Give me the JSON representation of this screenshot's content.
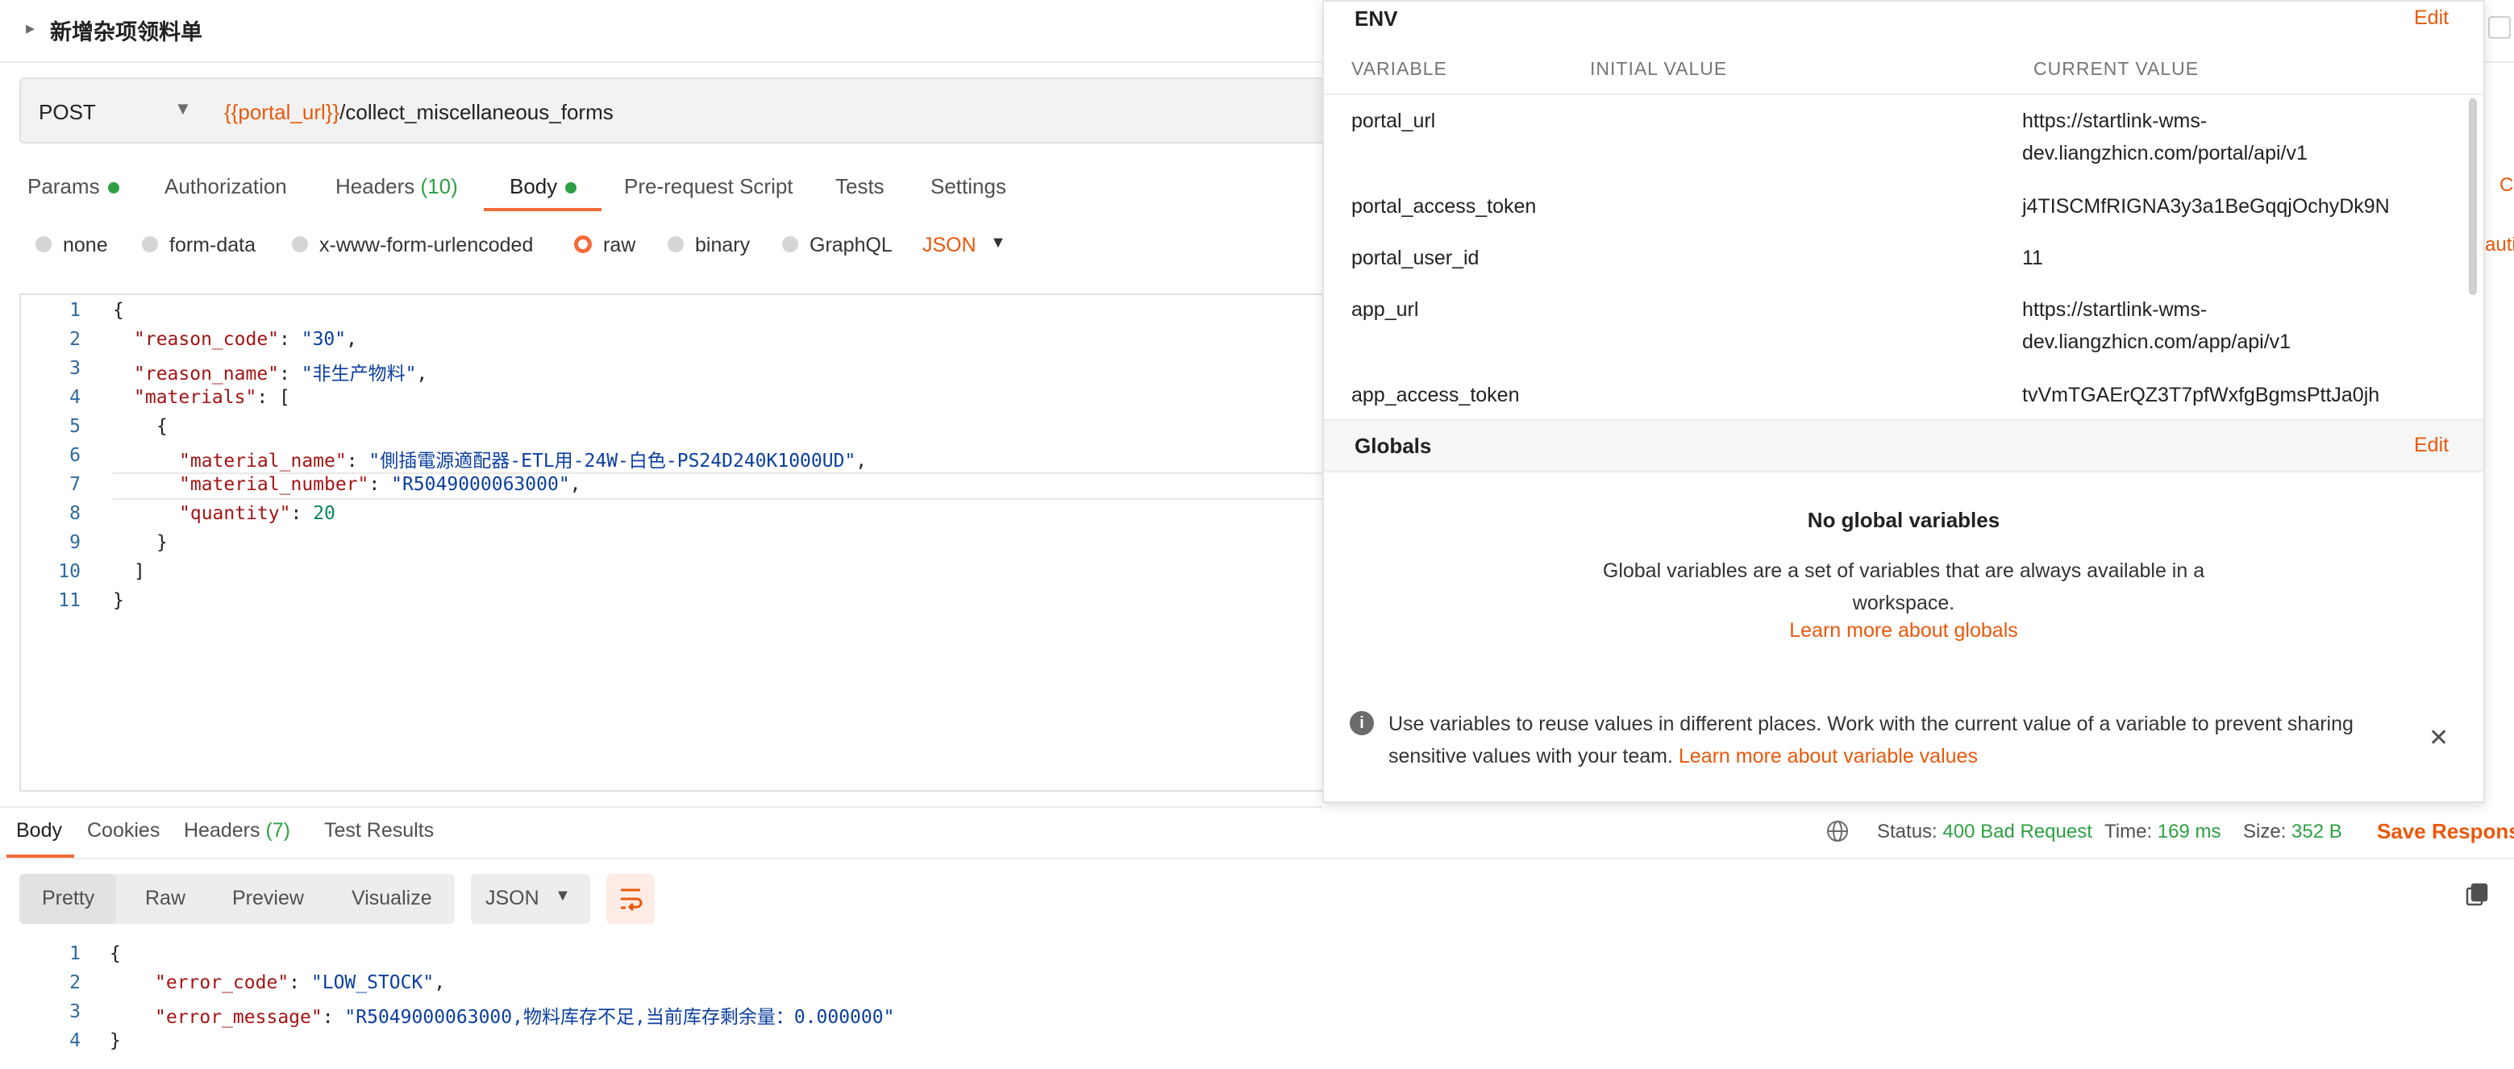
{
  "request": {
    "title": "新增杂项领料单",
    "method": "POST",
    "url_variable": "{{portal_url}}",
    "url_path": "/collect_miscellaneous_forms",
    "tabs": {
      "params": "Params",
      "authorization": "Authorization",
      "headers": "Headers",
      "headers_count": "(10)",
      "body": "Body",
      "prerequest": "Pre-request Script",
      "tests": "Tests",
      "settings": "Settings"
    },
    "body_types": {
      "none": "none",
      "form_data": "form-data",
      "urlencoded": "x-www-form-urlencoded",
      "raw": "raw",
      "binary": "binary",
      "graphql": "GraphQL",
      "format": "JSON"
    },
    "code": {
      "l1": "{",
      "l2_key": "\"reason_code\"",
      "l2_val": "\"30\"",
      "l3_key": "\"reason_name\"",
      "l3_val": "\"非生产物料\"",
      "l4_key": "\"materials\"",
      "l5": "{",
      "l6_key": "\"material_name\"",
      "l6_val": "\"側插電源適配器-ETL用-24W-白色-PS24D240K1000UD\"",
      "l7_key": "\"material_number\"",
      "l7_val": "\"R5049000063000\"",
      "l8_key": "\"quantity\"",
      "l8_val": "20",
      "l9": "}",
      "l10": "]",
      "l11": "}"
    },
    "line_numbers": [
      "1",
      "2",
      "3",
      "4",
      "5",
      "6",
      "7",
      "8",
      "9",
      "10",
      "11"
    ]
  },
  "response": {
    "tabs": {
      "body": "Body",
      "cookies": "Cookies",
      "headers": "Headers",
      "headers_count": "(7)",
      "test_results": "Test Results"
    },
    "status_label": "Status:",
    "status_value": "400 Bad Request",
    "time_label": "Time:",
    "time_value": "169 ms",
    "size_label": "Size:",
    "size_value": "352 B",
    "save_label": "Save Response",
    "view_modes": {
      "pretty": "Pretty",
      "raw": "Raw",
      "preview": "Preview",
      "visualize": "Visualize"
    },
    "format": "JSON",
    "code": {
      "l1": "{",
      "l2_key": "\"error_code\"",
      "l2_val": "\"LOW_STOCK\"",
      "l3_key": "\"error_message\"",
      "l3_val": "\"R5049000063000,物料库存不足,当前库存剩余量：0.000000\"",
      "l4": "}"
    },
    "line_numbers": [
      "1",
      "2",
      "3",
      "4"
    ]
  },
  "env_panel": {
    "title": "ENV",
    "edit_label": "Edit",
    "columns": {
      "variable": "VARIABLE",
      "initial": "INITIAL VALUE",
      "current": "CURRENT VALUE"
    },
    "variables": [
      {
        "name": "portal_url",
        "current": "https://startlink-wms-dev.liangzhicn.com/portal/api/v1"
      },
      {
        "name": "portal_access_token",
        "current": "j4TISCMfRIGNA3y3a1BeGqqjOchyDk9N"
      },
      {
        "name": "portal_user_id",
        "current": "11"
      },
      {
        "name": "app_url",
        "current": "https://startlink-wms-dev.liangzhicn.com/app/api/v1"
      },
      {
        "name": "app_access_token",
        "current": "tvVmTGAErQZ3T7pfWxfgBgmsPttJa0jh"
      }
    ],
    "globals": {
      "title": "Globals",
      "edit_label": "Edit",
      "empty_title": "No global variables",
      "empty_desc": "Global variables are a set of variables that are always available in a workspace.",
      "learn_link": "Learn more about globals"
    },
    "info": {
      "text": "Use variables to reuse values in different places. Work with the current value of a variable to prevent sharing sensitive values with your team.",
      "link": "Learn more about variable values"
    }
  },
  "edge": {
    "c": "C",
    "auto": "auti"
  },
  "colors": {
    "accent": "#f26b3a",
    "link": "#e8590c",
    "success": "#2ea043",
    "json_key": "#a31515",
    "json_string": "#0b3fa0",
    "json_number": "#098658"
  }
}
